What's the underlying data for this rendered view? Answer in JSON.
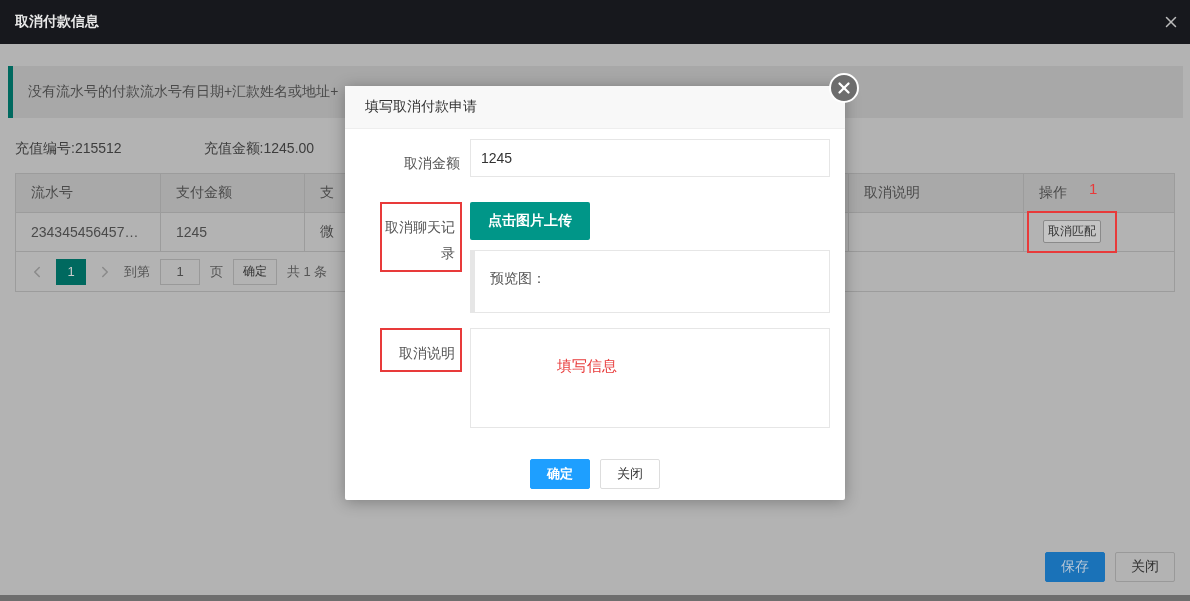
{
  "window": {
    "title": "取消付款信息"
  },
  "notice": "没有流水号的付款流水号有日期+汇款姓名或地址+",
  "info": [
    "充值编号:215512",
    "充值金额:1245.00"
  ],
  "table": {
    "columns": [
      "流水号",
      "支付金额",
      "支",
      "取消说明",
      "操作"
    ],
    "rows": [
      {
        "cells": [
          "234345456457…",
          "1245",
          "微"
        ],
        "action": {
          "label": "取消匹配",
          "highlighted": true,
          "note": "1"
        }
      }
    ]
  },
  "pagination": {
    "pages": [
      {
        "label": "1",
        "selected": true
      }
    ],
    "goto_label": "到第",
    "page_input": "1",
    "page_unit": "页",
    "confirm": "确定",
    "total": "共 1 条"
  },
  "footer_buttons": [
    {
      "label": "保存",
      "kind": "primary"
    },
    {
      "label": "关闭",
      "kind": "default"
    }
  ],
  "dialog": {
    "title": "填写取消付款申请",
    "fields": [
      {
        "kind": "input",
        "label": "取消金额",
        "value": "1245",
        "highlighted": false
      },
      {
        "kind": "upload",
        "label": "取消聊天记录",
        "button": "点击图片上传",
        "preview_label": "预览图：",
        "highlighted": true
      },
      {
        "kind": "textarea",
        "label": "取消说明",
        "highlighted": true,
        "note": "填写信息"
      }
    ],
    "buttons": [
      {
        "label": "确定",
        "kind": "primary"
      },
      {
        "label": "关闭",
        "kind": "default"
      }
    ]
  }
}
